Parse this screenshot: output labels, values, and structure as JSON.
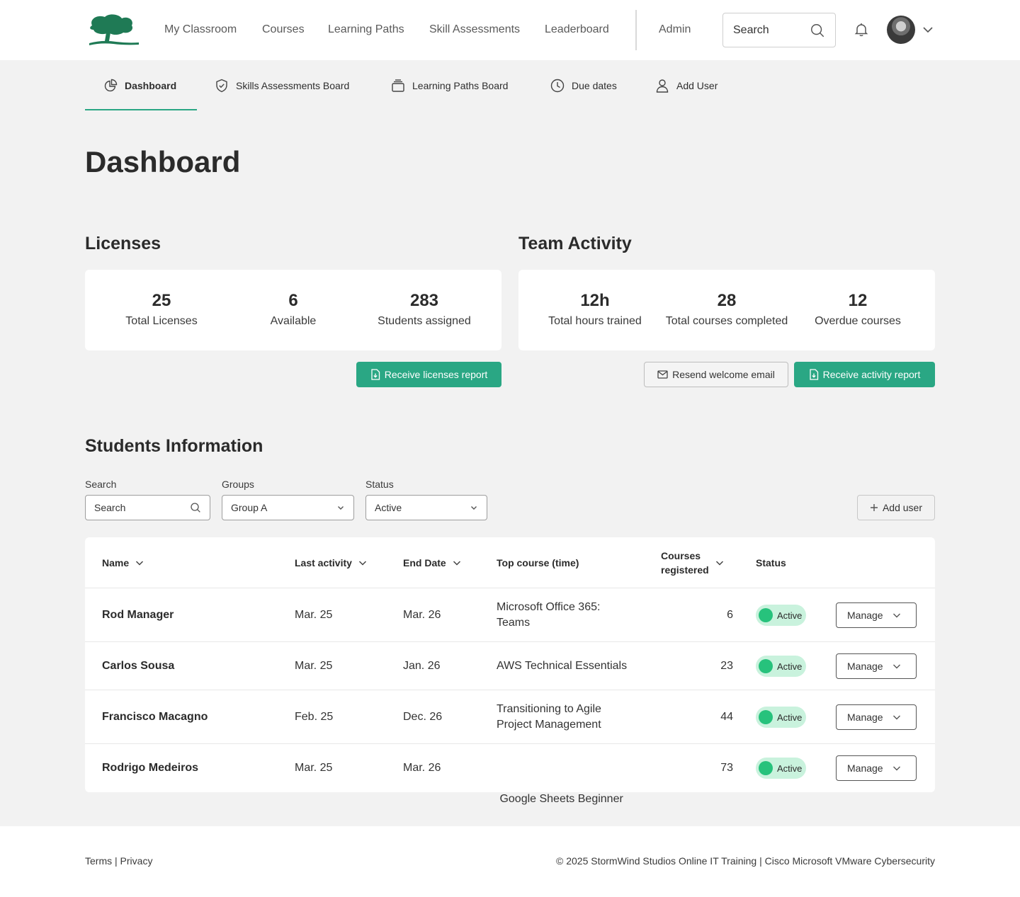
{
  "nav": {
    "links": [
      "My Classroom",
      "Courses",
      "Learning Paths",
      "Skill Assessments",
      "Leaderboard"
    ],
    "admin": "Admin",
    "search_placeholder": "Search"
  },
  "subnav": {
    "tabs": [
      "Dashboard",
      "Skills Assessments Board",
      "Learning Paths Board",
      "Due dates",
      "Add User"
    ]
  },
  "page": {
    "title": "Dashboard"
  },
  "licenses": {
    "title": "Licenses",
    "stats": [
      {
        "value": "25",
        "label": "Total Licenses"
      },
      {
        "value": "6",
        "label": "Available"
      },
      {
        "value": "283",
        "label": "Students assigned"
      }
    ],
    "report_button": "Receive licenses report"
  },
  "team": {
    "title": "Team Activity",
    "stats": [
      {
        "value": "12h",
        "label": "Total hours trained"
      },
      {
        "value": "28",
        "label": "Total courses completed"
      },
      {
        "value": "12",
        "label": "Overdue courses"
      }
    ],
    "resend_button": "Resend welcome email",
    "report_button": "Receive activity report"
  },
  "students": {
    "title": "Students Information",
    "filters": {
      "search_label": "Search",
      "search_placeholder": "Search",
      "groups_label": "Groups",
      "groups_value": "Group A",
      "status_label": "Status",
      "status_value": "Active"
    },
    "add_user": "Add user",
    "columns": {
      "name": "Name",
      "last_activity": "Last activity",
      "end_date": "End Date",
      "top_course": "Top course (time)",
      "courses_registered_1": "Courses",
      "courses_registered_2": "registered",
      "status": "Status"
    },
    "rows": [
      {
        "name": "Rod Manager",
        "last": "Mar. 25",
        "end": "Mar. 26",
        "course_1": "Microsoft Office 365:",
        "course_2": "Teams",
        "count": "6",
        "status": "Active",
        "action": "Manage"
      },
      {
        "name": "Carlos Sousa",
        "last": "Mar. 25",
        "end": "Jan. 26",
        "course_1": "AWS Technical Essentials",
        "course_2": "",
        "count": "23",
        "status": "Active",
        "action": "Manage"
      },
      {
        "name": "Francisco Macagno",
        "last": "Feb. 25",
        "end": "Dec. 26",
        "course_1": "Transitioning to Agile",
        "course_2": "Project Management",
        "count": "44",
        "status": "Active",
        "action": "Manage"
      },
      {
        "name": "Rodrigo Medeiros",
        "last": "Mar. 25",
        "end": "Mar. 26",
        "course_1": " Google Sheets Beginner",
        "course_2": "",
        "count": "73",
        "status": "Active",
        "action": "Manage"
      }
    ]
  },
  "footer": {
    "terms": "Terms",
    "sep": "|",
    "privacy": "Privacy",
    "copyright": "© 2025 StormWind Studios Online IT Training | Cisco Microsoft VMware Cybersecurity"
  },
  "colors": {
    "accent": "#2aa784",
    "status_bg": "#c9f2dd",
    "status_dot": "#27c27c",
    "logo": "#1f7a55"
  }
}
